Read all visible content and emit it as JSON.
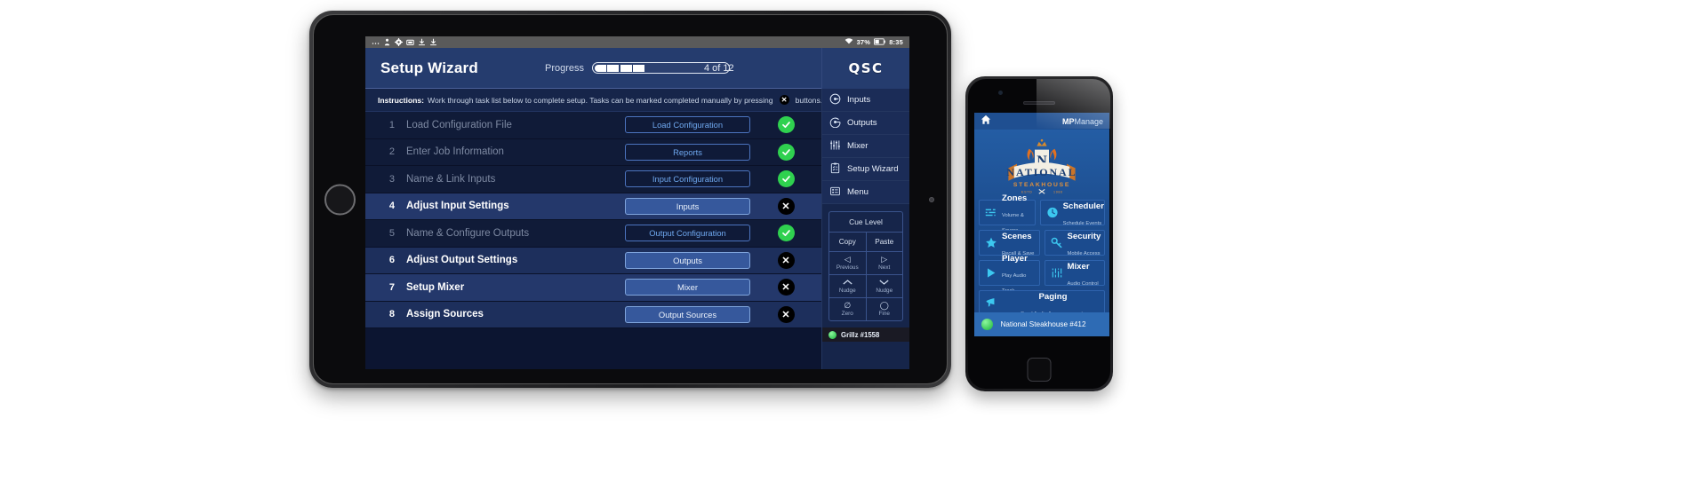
{
  "tablet": {
    "status_bar": {
      "left_icons": [
        "more-icon",
        "person-icon",
        "gear-icon",
        "screenshot-icon",
        "download-icon",
        "download-icon"
      ],
      "wifi_icon": "wifi-icon",
      "battery_percent": "37%",
      "battery_icon": "battery-icon",
      "time": "8:35"
    },
    "header": {
      "title": "Setup Wizard",
      "progress_label": "Progress",
      "progress_filled": 4,
      "progress_total": 12,
      "progress_count": "4 of 12",
      "brand": "QSC"
    },
    "instructions": {
      "label": "Instructions:",
      "text_before": "Work through task list below to complete setup.  Tasks can be marked completed manually by pressing",
      "x_icon": "close-icon",
      "text_after": "buttons."
    },
    "tasks": [
      {
        "num": "1",
        "name": "Load Configuration File",
        "button": "Load Configuration",
        "state": "done",
        "status_icon": "check-icon"
      },
      {
        "num": "2",
        "name": "Enter Job Information",
        "button": "Reports",
        "state": "done",
        "status_icon": "check-icon"
      },
      {
        "num": "3",
        "name": "Name & Link Inputs",
        "button": "Input Configuration",
        "state": "done",
        "status_icon": "check-icon"
      },
      {
        "num": "4",
        "name": "Adjust Input Settings",
        "button": "Inputs",
        "state": "todo",
        "status_icon": "close-icon"
      },
      {
        "num": "5",
        "name": "Name & Configure Outputs",
        "button": "Output Configuration",
        "state": "done",
        "status_icon": "check-icon"
      },
      {
        "num": "6",
        "name": "Adjust Output Settings",
        "button": "Outputs",
        "state": "todo",
        "status_icon": "close-icon"
      },
      {
        "num": "7",
        "name": "Setup Mixer",
        "button": "Mixer",
        "state": "todo",
        "status_icon": "close-icon"
      },
      {
        "num": "8",
        "name": "Assign Sources",
        "button": "Output Sources",
        "state": "todo",
        "status_icon": "close-icon"
      }
    ],
    "sidebar": {
      "items": [
        {
          "label": "Inputs",
          "icon": "input-circle-icon"
        },
        {
          "label": "Outputs",
          "icon": "output-circle-icon"
        },
        {
          "label": "Mixer",
          "icon": "faders-icon"
        },
        {
          "label": "Setup Wizard",
          "icon": "clipboard-checklist-icon"
        },
        {
          "label": "Menu",
          "icon": "menu-list-icon"
        }
      ],
      "pad": {
        "cue_level": "Cue Level",
        "copy": "Copy",
        "paste": "Paste",
        "previous": "Previous",
        "previous_glyph": "◁",
        "next": "Next",
        "next_glyph": "▷",
        "nudge_up": "Nudge",
        "nudge_up_glyph": "︿",
        "nudge_down": "Nudge",
        "nudge_down_glyph": "﹀",
        "zero": "Zero",
        "zero_glyph": "∅",
        "fine": "Fine",
        "fine_glyph": "◯"
      },
      "status": {
        "device_name": "Grillz #1558",
        "indicator_icon": "status-online-icon"
      }
    }
  },
  "phone": {
    "top": {
      "home_icon": "home-icon",
      "brand_bold": "MP",
      "brand_light": "Manage"
    },
    "logo": {
      "monogram": "N",
      "wordmark": "NATIONAL",
      "subtitle": "STEAKHOUSE",
      "established_left": "ESTD",
      "established_right": "1980",
      "crown_icon": "crown-icon",
      "flame_icon": "flame-icon",
      "utensils_icon": "crossed-utensils-icon"
    },
    "tiles": [
      {
        "title": "Zones",
        "sub": "Volume & Source",
        "icon": "sliders-icon",
        "wide": false
      },
      {
        "title": "Scheduler",
        "sub": "Schedule Events",
        "icon": "clock-icon",
        "wide": false
      },
      {
        "title": "Scenes",
        "sub": "Recall & Save",
        "icon": "star-icon",
        "wide": false
      },
      {
        "title": "Security",
        "sub": "Mobile Access",
        "icon": "key-icon",
        "wide": false
      },
      {
        "title": "Player",
        "sub": "Play Audio Track",
        "icon": "play-icon",
        "wide": false
      },
      {
        "title": "Mixer",
        "sub": "Audio Control",
        "icon": "faders-icon",
        "wide": false
      },
      {
        "title": "Paging",
        "sub": "Send Audio Announcements",
        "icon": "megaphone-icon",
        "wide": true
      }
    ],
    "footer": {
      "indicator_icon": "status-online-icon",
      "label": "National Steakhouse #412"
    }
  },
  "colors": {
    "accent_blue": "#36589c",
    "header_blue": "#253c6e",
    "sidebar_blue": "#1b2c57",
    "status_green": "#2fd14f",
    "phone_blue": "#1f4f91",
    "phone_tile": "#1b4b8e",
    "tile_icon_cyan": "#3cc8f0",
    "logo_gold": "#d68a2e"
  }
}
